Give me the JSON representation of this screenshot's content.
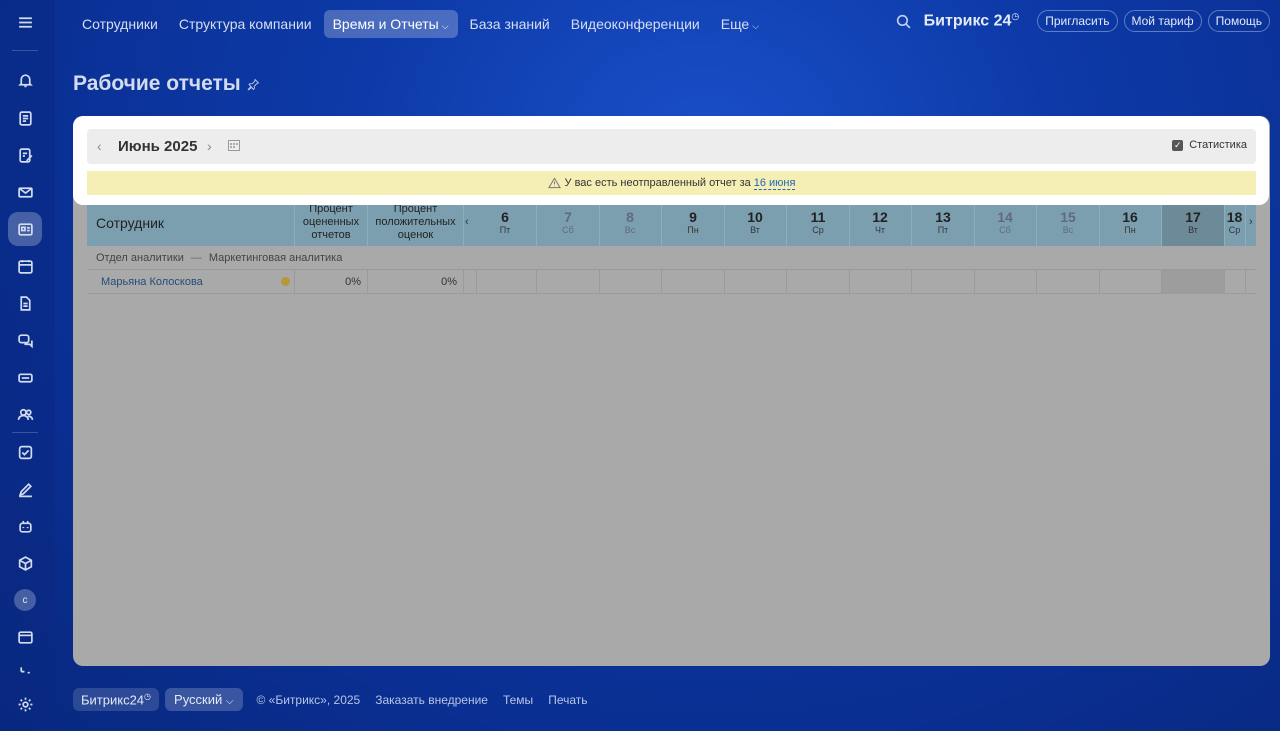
{
  "nav": {
    "items": [
      {
        "label": "Сотрудники"
      },
      {
        "label": "Структура компании"
      },
      {
        "label": "Время и Отчеты",
        "active": true,
        "chevron": true
      },
      {
        "label": "База знаний"
      },
      {
        "label": "Видеоконференции"
      },
      {
        "label": "Еще",
        "chevron": true
      }
    ],
    "brand": "Битрикс 24",
    "invite": "Пригласить",
    "tariff": "Мой тариф",
    "help": "Помощь"
  },
  "sidebar": {
    "avatar_letter": "с",
    "icons": [
      "menu-icon",
      "bell-icon",
      "news-icon",
      "tasks-edit-icon",
      "mail-icon",
      "reports-icon",
      "calendar-icon",
      "document-icon",
      "chat-icon",
      "drive-icon",
      "group-icon",
      "checkbox-icon",
      "sign-icon",
      "bot-icon",
      "box-icon",
      "avatar",
      "window-icon",
      "more-icon",
      "settings-icon"
    ]
  },
  "page": {
    "title": "Рабочие отчеты"
  },
  "calendar": {
    "month_title": "Июнь 2025",
    "stat_label": "Статистика",
    "warning_text": "У вас есть неотправленный отчет за",
    "warning_link": "16 июня"
  },
  "table": {
    "emp_header": "Сотрудник",
    "pct_rated_header": "Процент оцененных отчетов",
    "pct_positive_header": "Процент положительных оценок",
    "days": [
      {
        "num": "6",
        "wd": "Пт",
        "weekend": false
      },
      {
        "num": "7",
        "wd": "Сб",
        "weekend": true
      },
      {
        "num": "8",
        "wd": "Вс",
        "weekend": true
      },
      {
        "num": "9",
        "wd": "Пн",
        "weekend": false
      },
      {
        "num": "10",
        "wd": "Вт",
        "weekend": false
      },
      {
        "num": "11",
        "wd": "Ср",
        "weekend": false
      },
      {
        "num": "12",
        "wd": "Чт",
        "weekend": false
      },
      {
        "num": "13",
        "wd": "Пт",
        "weekend": false
      },
      {
        "num": "14",
        "wd": "Сб",
        "weekend": true
      },
      {
        "num": "15",
        "wd": "Вс",
        "weekend": true
      },
      {
        "num": "16",
        "wd": "Пн",
        "weekend": false
      },
      {
        "num": "17",
        "wd": "Вт",
        "weekend": false,
        "today": true
      },
      {
        "num": "18",
        "wd": "Ср",
        "weekend": false
      }
    ],
    "dept": "Отдел аналитики",
    "dept_sep": "—",
    "subdept": "Маркетинговая аналитика",
    "rows": [
      {
        "name": "Марьяна Колоскова",
        "pct_rated": "0%",
        "pct_positive": "0%"
      }
    ]
  },
  "footer": {
    "brand": "Битрикс24",
    "lang": "Русский",
    "copyright": "© «Битрикс», 2025",
    "order": "Заказать внедрение",
    "themes": "Темы",
    "print": "Печать"
  }
}
